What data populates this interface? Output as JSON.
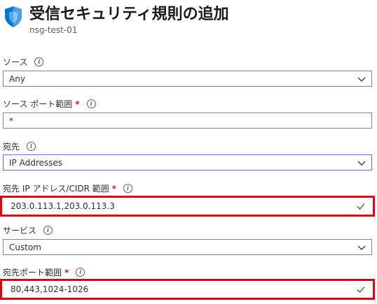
{
  "header": {
    "title": "受信セキュリティ規則の追加",
    "subtitle": "nsg-test-01",
    "icon": "shield-icon",
    "icon_color": "#0078d4"
  },
  "fields": {
    "source": {
      "label": "ソース",
      "value": "Any",
      "required": false
    },
    "source_port": {
      "label": "ソース ポート範囲",
      "value": "*",
      "required": true
    },
    "destination": {
      "label": "宛先",
      "value": "IP Addresses",
      "required": false
    },
    "dest_ip": {
      "label": "宛先 IP アドレス/CIDR 範囲",
      "value": "203.0.113.1,203.0.113.3",
      "required": true,
      "valid": true
    },
    "service": {
      "label": "サービス",
      "value": "Custom",
      "required": false
    },
    "dest_port": {
      "label": "宛先ポート範囲",
      "value": "80,443,1024-1026",
      "required": true,
      "valid": true
    }
  },
  "info_glyph": "i",
  "required_glyph": "*",
  "colors": {
    "highlight": "#c50f1f",
    "valid_check": "#107c10",
    "required": "#a4262c"
  }
}
